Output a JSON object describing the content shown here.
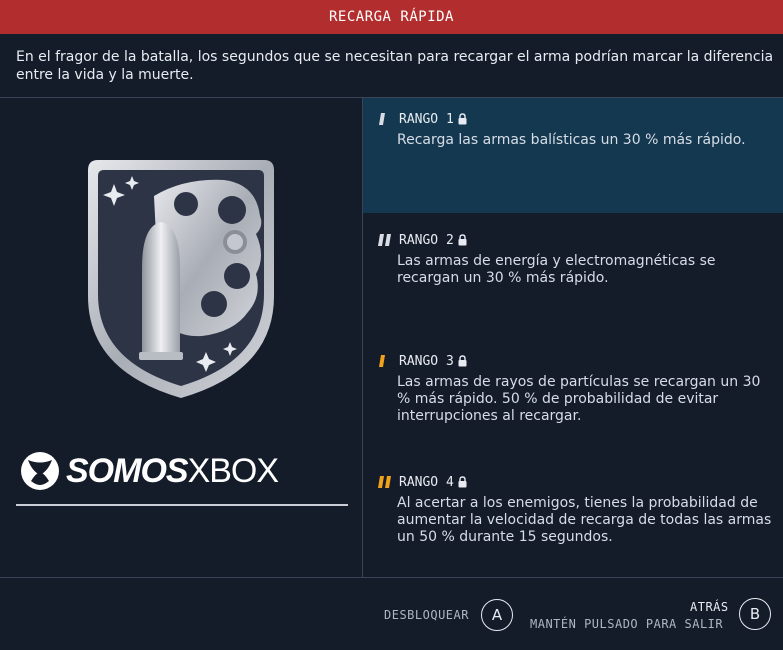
{
  "header": {
    "title": "RECARGA RÁPIDA"
  },
  "description": "En el fragor de la batalla, los segundos que se necesitan para recargar el arma podrían marcar la diferencia entre la vida y la muerte.",
  "logo": {
    "part1": "SOMOS",
    "part2": "XBOX"
  },
  "ranks": [
    {
      "label": "RANGO 1",
      "text": "Recarga las armas balísticas un 30 % más rápido.",
      "selected": true,
      "icon": "rank-bar-1",
      "color": "#d8dde5"
    },
    {
      "label": "RANGO 2",
      "text": "Las armas de energía y electromagnéticas se recargan un 30 % más rápido.",
      "selected": false,
      "icon": "rank-bar-2",
      "color": "#d8dde5"
    },
    {
      "label": "RANGO 3",
      "text": "Las armas de rayos de partículas se recargan un 30 % más rápido. 50 % de probabilidad de evitar interrupciones al recargar.",
      "selected": false,
      "icon": "rank-bar-3",
      "color": "#f0a21b"
    },
    {
      "label": "RANGO 4",
      "text": "Al acertar a los enemigos, tienes la probabilidad de aumentar la velocidad de recarga de todas las armas un 50 % durante 15 segundos.",
      "selected": false,
      "icon": "rank-bar-4",
      "color": "#f0a21b"
    }
  ],
  "footer": {
    "unlock_label": "DESBLOQUEAR",
    "unlock_button": "A",
    "back_label": "ATRÁS",
    "back_hint": "MANTÉN PULSADO PARA SALIR",
    "back_button": "B"
  },
  "colors": {
    "title_bar": "#b22e2e",
    "background": "#141b29",
    "selected_row": "#14384f",
    "accent_gold": "#f0a21b"
  }
}
